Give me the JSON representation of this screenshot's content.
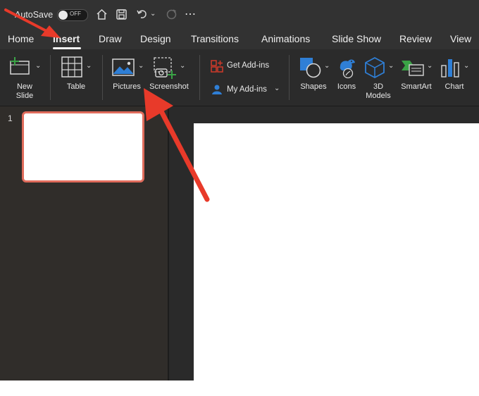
{
  "titlebar": {
    "autosave_label": "AutoSave",
    "autosave_state": "OFF"
  },
  "tabs": [
    "Home",
    "Insert",
    "Draw",
    "Design",
    "Transitions",
    "Animations",
    "Slide Show",
    "Review",
    "View"
  ],
  "active_tab": "Insert",
  "ribbon": {
    "new_slide": "New\nSlide",
    "table": "Table",
    "pictures": "Pictures",
    "screenshot": "Screenshot",
    "get_addins": "Get Add-ins",
    "my_addins": "My Add-ins",
    "shapes": "Shapes",
    "icons": "Icons",
    "models_3d": "3D\nModels",
    "smartart": "SmartArt",
    "chart": "Chart"
  },
  "slides_pane": {
    "slide_number": "1"
  },
  "colors": {
    "accent_arrow": "#e83a2a",
    "thumb_border": "#e06c5c",
    "icon_blue": "#2f7fd6",
    "icon_green": "#3aa346",
    "icon_red": "#d23a2a"
  }
}
